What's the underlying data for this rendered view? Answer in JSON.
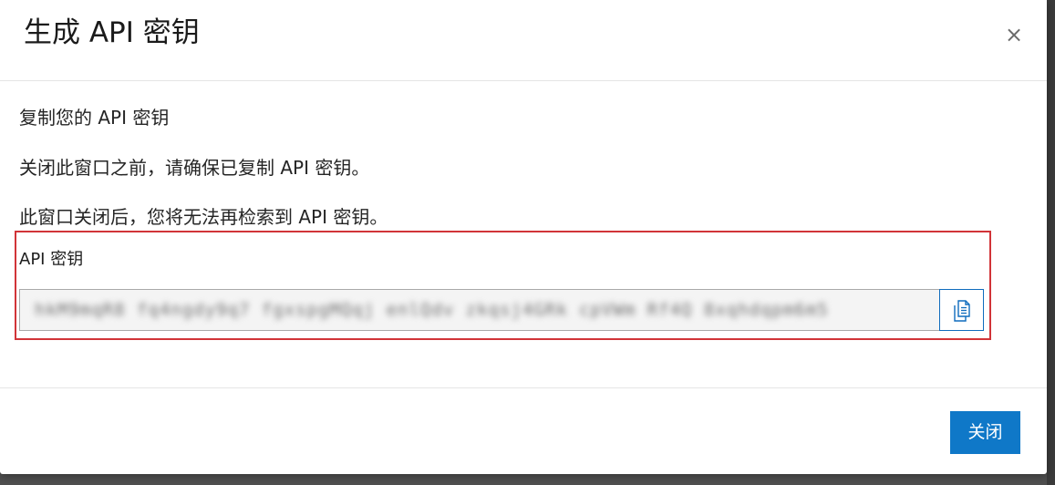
{
  "dialog": {
    "title": "生成 API 密钥",
    "close_icon_glyph": "×",
    "body": {
      "line_1": "复制您的 API 密钥",
      "line_2": "关闭此窗口之前，请确保已复制 API 密钥。",
      "line_3": "此窗口关闭后，您将无法再检索到 API 密钥。"
    },
    "key_field": {
      "label": "API 密钥",
      "value": "hkM9mqR8 fq4ngdy9q7 fgxspgMQqj enlQdv zkqsj4GRk cpVWm Rf4Q 8xqhdqpm6m5"
    },
    "footer": {
      "close_button_label": "关闭"
    }
  },
  "colors": {
    "accent": "#0f78c8",
    "highlight_border": "#d13438"
  },
  "icons": {
    "close": "close-icon",
    "copy": "copy-icon"
  }
}
